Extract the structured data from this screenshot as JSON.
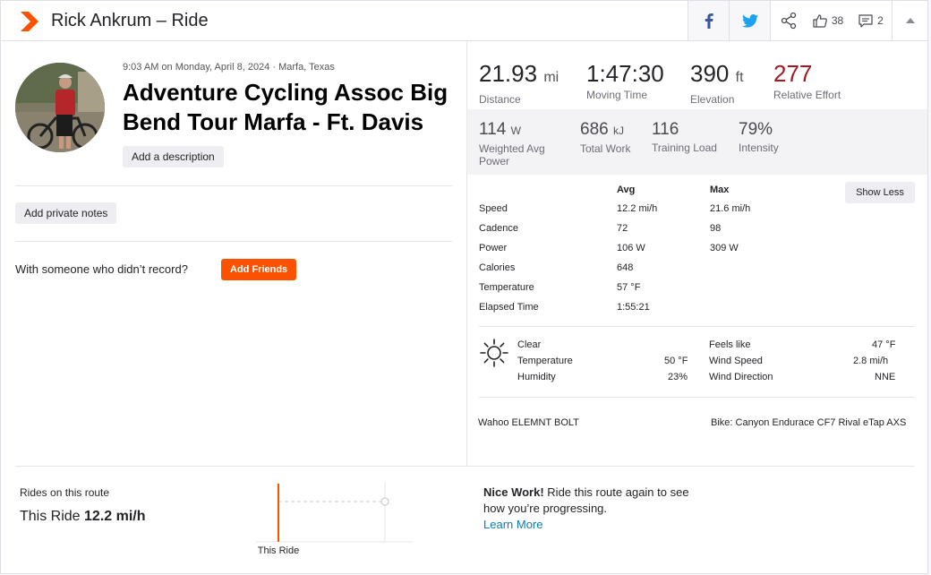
{
  "header": {
    "title": "Rick Ankrum – Ride",
    "kudos_count": "38",
    "comment_count": "2"
  },
  "activity": {
    "meta": "9:03 AM on Monday, April 8, 2024 · Marfa, Texas",
    "title": "Adventure Cycling Assoc Big Bend Tour Marfa - Ft. Davis",
    "add_description": "Add a description",
    "add_private_notes": "Add private notes",
    "with_someone": "With someone who didn’t record?",
    "add_friends": "Add Friends"
  },
  "primary_stats": [
    {
      "value": "21.93",
      "unit": "mi",
      "label": "Distance"
    },
    {
      "value": "1:47:30",
      "unit": "",
      "label": "Moving Time"
    },
    {
      "value": "390",
      "unit": "ft",
      "label": "Elevation"
    },
    {
      "value": "277",
      "unit": "",
      "label": "Relative Effort"
    }
  ],
  "secondary_stats": [
    {
      "value": "114",
      "unit": "W",
      "label": "Weighted Avg Power"
    },
    {
      "value": "686",
      "unit": "kJ",
      "label": "Total Work"
    },
    {
      "value": "116",
      "unit": "",
      "label": "Training Load"
    },
    {
      "value": "79%",
      "unit": "",
      "label": "Intensity"
    }
  ],
  "details": {
    "avg_header": "Avg",
    "max_header": "Max",
    "show_less": "Show Less",
    "rows": [
      {
        "label": "Speed",
        "avg": "12.2 mi/h",
        "max": "21.6 mi/h"
      },
      {
        "label": "Cadence",
        "avg": "72",
        "max": "98"
      },
      {
        "label": "Power",
        "avg": "106 W",
        "max": "309 W"
      },
      {
        "label": "Calories",
        "avg": "648",
        "max": ""
      },
      {
        "label": "Temperature",
        "avg": "57 °F",
        "max": ""
      },
      {
        "label": "Elapsed Time",
        "avg": "1:55:21",
        "max": ""
      }
    ]
  },
  "weather": {
    "condition": "Clear",
    "temperature_label": "Temperature",
    "temperature": "50 °F",
    "humidity_label": "Humidity",
    "humidity": "23%",
    "feels_like_label": "Feels like",
    "feels_like": "47 °F",
    "wind_speed_label": "Wind Speed",
    "wind_speed": "2.8 mi/h",
    "wind_direction_label": "Wind Direction",
    "wind_direction": "NNE"
  },
  "gear": {
    "device": "Wahoo ELEMNT BOLT",
    "bike": "Bike: Canyon Endurace CF7 Rival eTap AXS"
  },
  "route": {
    "label": "Rides on this route",
    "this_ride_prefix": "This Ride",
    "this_ride_speed": "12.2 mi/h",
    "chart_label": "This Ride",
    "nice_work": "Nice Work!",
    "nice_text": "Ride this route again to see how you’re progressing.",
    "learn_more": "Learn More"
  },
  "colors": {
    "brand": "#fc5200",
    "relative_effort": "#a4191f",
    "link": "#0a7bb0"
  }
}
